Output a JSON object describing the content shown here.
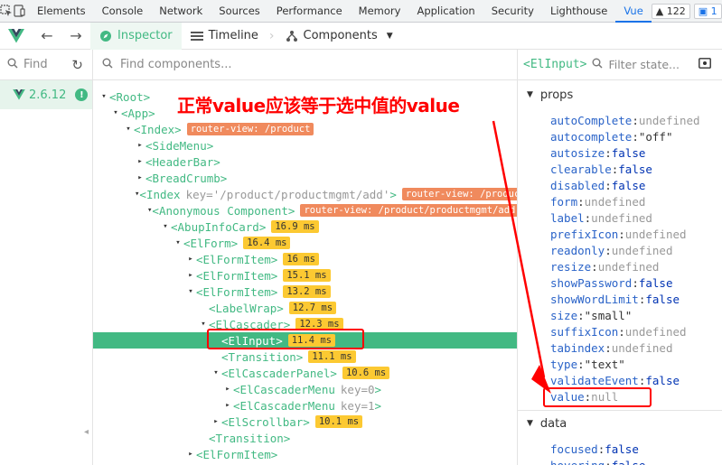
{
  "devtools": {
    "tabs": [
      "Elements",
      "Console",
      "Network",
      "Sources",
      "Performance",
      "Memory",
      "Application",
      "Security",
      "Lighthouse",
      "Vue"
    ],
    "active_tab": "Vue",
    "warnings_count": "122",
    "messages_count": "1"
  },
  "vue_toolbar": {
    "inspector_label": "Inspector",
    "timeline_label": "Timeline",
    "components_label": "Components"
  },
  "left_column": {
    "find_label": "Find",
    "version": "2.6.12"
  },
  "tree": {
    "search_placeholder": "Find components...",
    "rows": [
      {
        "toggle": "▾",
        "name": "<Root>"
      },
      {
        "toggle": "▾",
        "name": "<App>"
      },
      {
        "toggle": "▾",
        "name": "<Index>",
        "route": "router-view: /product"
      },
      {
        "toggle": "▸",
        "name": "<SideMenu>"
      },
      {
        "toggle": "▸",
        "name": "<HeaderBar>"
      },
      {
        "toggle": "▸",
        "name": "<BreadCrumb>"
      },
      {
        "toggle": "▾",
        "name": "<Index",
        "key": "'/product/productmgmt/add'",
        "close": ">",
        "route": "router-view: /product/productmgmt/add"
      },
      {
        "toggle": "▾",
        "name": "<Anonymous Component>",
        "route": "router-view: /product/productmgmt/add"
      },
      {
        "toggle": "▾",
        "name": "<AbupInfoCard>",
        "time": "16.9 ms"
      },
      {
        "toggle": "▾",
        "name": "<ElForm>",
        "time": "16.4 ms"
      },
      {
        "toggle": "▸",
        "name": "<ElFormItem>",
        "time": "16 ms"
      },
      {
        "toggle": "▸",
        "name": "<ElFormItem>",
        "time": "15.1 ms"
      },
      {
        "toggle": "▾",
        "name": "<ElFormItem>",
        "time": "13.2 ms"
      },
      {
        "toggle": "",
        "name": "<LabelWrap>",
        "time": "12.7 ms"
      },
      {
        "toggle": "▾",
        "name": "<ElCascader>",
        "time": "12.3 ms"
      },
      {
        "toggle": "",
        "name": "<ElInput>",
        "time": "11.4 ms",
        "selected": true
      },
      {
        "toggle": "",
        "name": "<Transition>",
        "time": "11.1 ms"
      },
      {
        "toggle": "▾",
        "name": "<ElCascaderPanel>",
        "time": "10.6 ms"
      },
      {
        "toggle": "▸",
        "name": "<ElCascaderMenu",
        "key": "0",
        "close": ">"
      },
      {
        "toggle": "▸",
        "name": "<ElCascaderMenu",
        "key": "1",
        "close": ">"
      },
      {
        "toggle": "▸",
        "name": "<ElScrollbar>",
        "time": "10.1 ms"
      },
      {
        "toggle": "",
        "name": "<Transition>"
      },
      {
        "toggle": "▸",
        "name": "<ElFormItem>"
      }
    ]
  },
  "state": {
    "component": "<ElInput>",
    "filter_placeholder": "Filter state...",
    "props_label": "props",
    "props": [
      {
        "key": "autoComplete",
        "value": "undefined",
        "kind": "null"
      },
      {
        "key": "autocomplete",
        "value": "\"off\"",
        "kind": "str"
      },
      {
        "key": "autosize",
        "value": "false",
        "kind": "bool"
      },
      {
        "key": "clearable",
        "value": "false",
        "kind": "bool"
      },
      {
        "key": "disabled",
        "value": "false",
        "kind": "bool"
      },
      {
        "key": "form",
        "value": "undefined",
        "kind": "null"
      },
      {
        "key": "label",
        "value": "undefined",
        "kind": "null"
      },
      {
        "key": "prefixIcon",
        "value": "undefined",
        "kind": "null"
      },
      {
        "key": "readonly",
        "value": "undefined",
        "kind": "null"
      },
      {
        "key": "resize",
        "value": "undefined",
        "kind": "null"
      },
      {
        "key": "showPassword",
        "value": "false",
        "kind": "bool"
      },
      {
        "key": "showWordLimit",
        "value": "false",
        "kind": "bool"
      },
      {
        "key": "size",
        "value": "\"small\"",
        "kind": "str"
      },
      {
        "key": "suffixIcon",
        "value": "undefined",
        "kind": "null"
      },
      {
        "key": "tabindex",
        "value": "undefined",
        "kind": "null"
      },
      {
        "key": "type",
        "value": "\"text\"",
        "kind": "str"
      },
      {
        "key": "validateEvent",
        "value": "false",
        "kind": "bool"
      },
      {
        "key": "value",
        "value": "null",
        "kind": "null"
      }
    ],
    "data_label": "data",
    "data": [
      {
        "key": "focused",
        "value": "false",
        "kind": "bool"
      },
      {
        "key": "hovering",
        "value": "false",
        "kind": "bool"
      }
    ]
  },
  "annotation": {
    "text": "正常value应该等于选中值的value",
    "color": "#ff0000"
  },
  "colors": {
    "vue_green": "#42b983",
    "time_badge": "#fcc932",
    "route_badge": "#f08a5d",
    "devtools_blue": "#1a73e8"
  }
}
